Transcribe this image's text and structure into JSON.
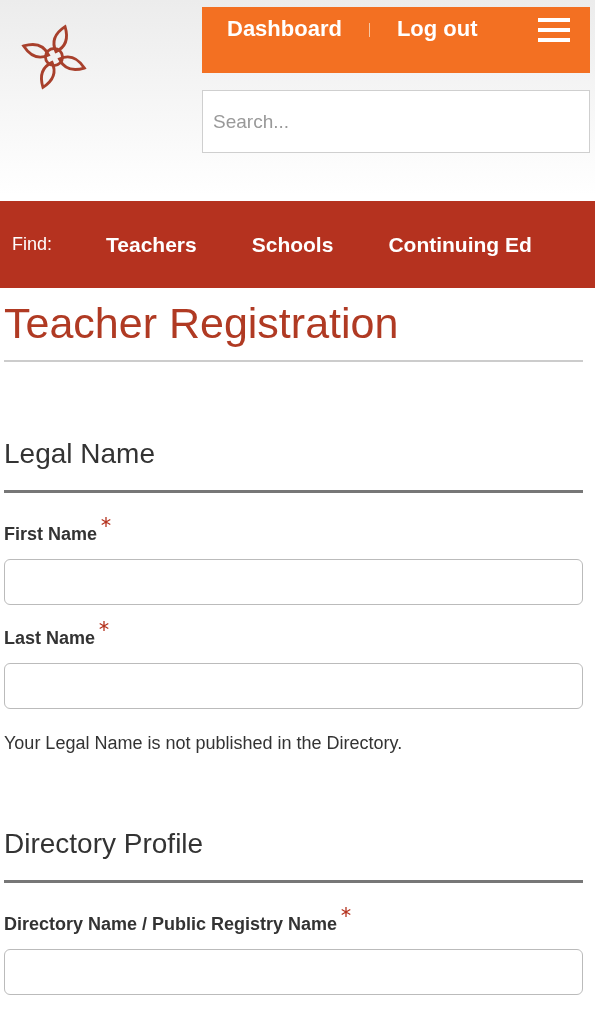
{
  "header": {
    "links": [
      "Dashboard",
      "Log out"
    ],
    "search": {
      "placeholder": "Search..."
    }
  },
  "find_bar": {
    "label": "Find:",
    "links": [
      "Teachers",
      "Schools",
      "Continuing Ed"
    ]
  },
  "page_title": "Teacher Registration",
  "sections": [
    {
      "title": "Legal Name",
      "fields": [
        {
          "label": "First Name",
          "required": true
        },
        {
          "label": "Last Name",
          "required": true
        }
      ],
      "note": "Your Legal Name is not published in the Directory."
    },
    {
      "title": "Directory Profile",
      "fields": [
        {
          "label": "Directory Name / Public Registry Name",
          "required": true
        }
      ]
    }
  ]
}
